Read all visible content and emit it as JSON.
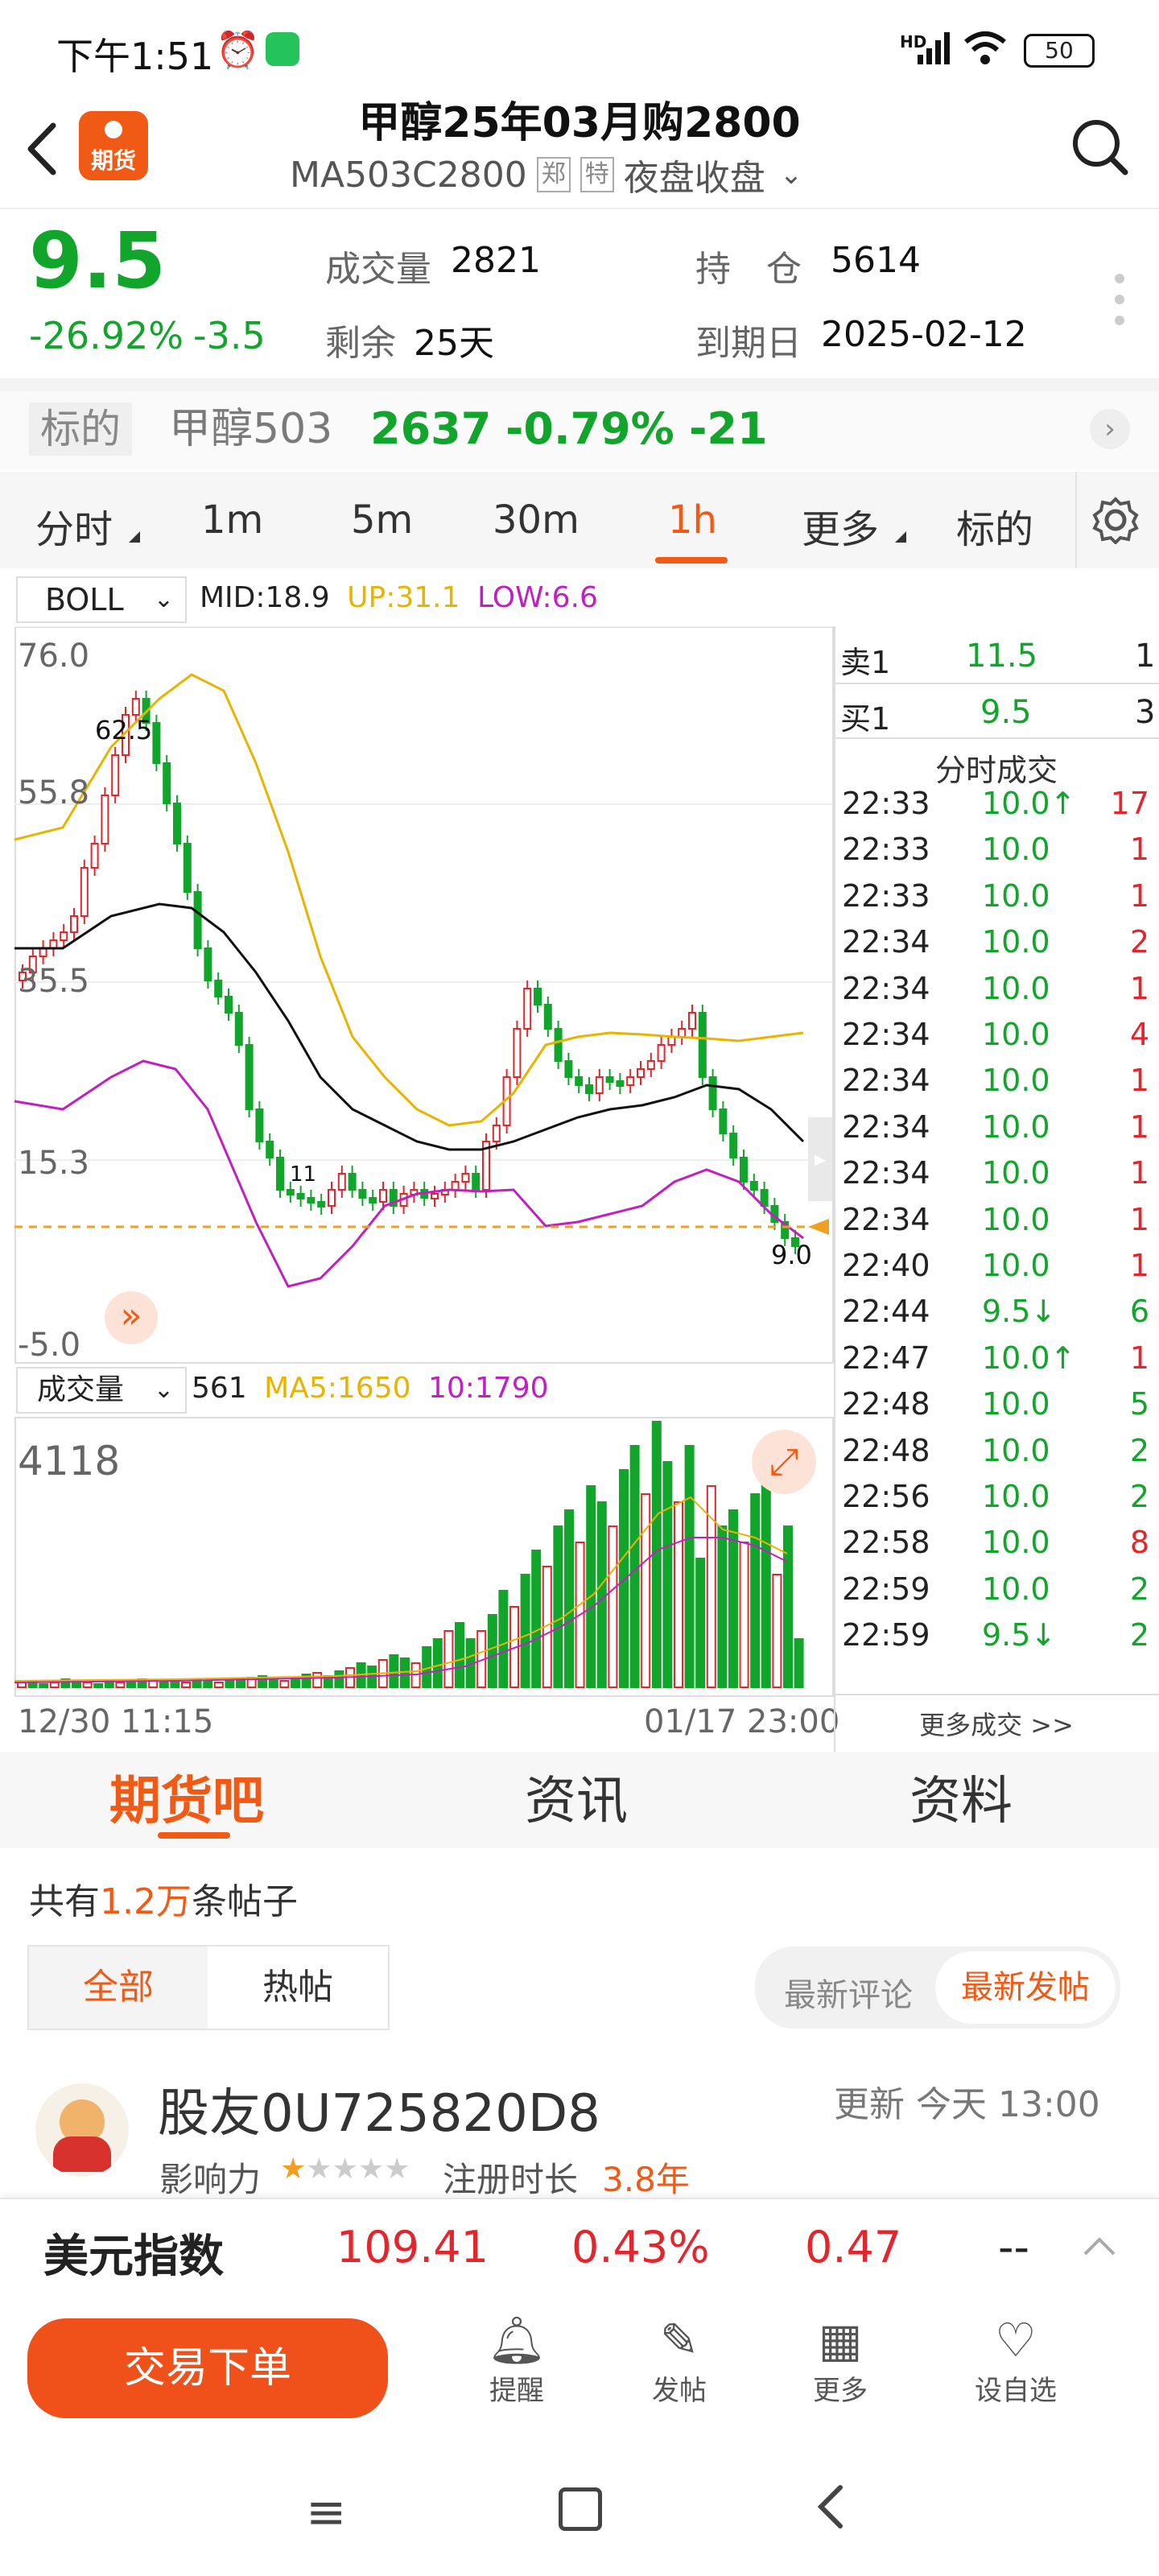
{
  "status_bar": {
    "time": "下午1:51",
    "network": "HD",
    "battery": "50"
  },
  "header": {
    "title": "甲醇25年03月购2800",
    "code": "MA503C2800",
    "tag1": "郑",
    "tag2": "特",
    "session": "夜盘收盘",
    "logo_text": "期货"
  },
  "quote": {
    "price": "9.5",
    "change_pct": "-26.92%",
    "change": "-3.5",
    "volume_label": "成交量",
    "volume": "2821",
    "oi_label": "持　仓",
    "oi": "5614",
    "remain_label": "剩余",
    "remain": "25天",
    "expiry_label": "到期日",
    "expiry": "2025-02-12"
  },
  "underlying": {
    "label": "标的",
    "name": "甲醇503",
    "price": "2637",
    "pct": "-0.79%",
    "change": "-21"
  },
  "timeframes": [
    "分时",
    "1m",
    "5m",
    "30m",
    "1h",
    "更多",
    "标的"
  ],
  "active_timeframe": "1h",
  "indicator": {
    "name": "BOLL",
    "mid": "MID:18.9",
    "up": "UP:31.1",
    "low": "LOW:6.6"
  },
  "chart": {
    "y_labels": [
      "76.0",
      "55.8",
      "35.5",
      "15.3",
      "-5.0"
    ],
    "high_label": "62.5",
    "low_label": "11",
    "last_label": "9.0",
    "x_start": "12/30 11:15",
    "x_end": "01/17 23:00"
  },
  "volume_panel": {
    "name": "成交量",
    "value": "561",
    "ma5": "MA5:1650",
    "ma10": "10:1790",
    "max": "4118"
  },
  "orderbook": {
    "sell_label": "卖1",
    "sell_price": "11.5",
    "sell_qty": "1",
    "buy_label": "买1",
    "buy_price": "9.5",
    "buy_qty": "3",
    "trades_title": "分时成交",
    "more": "更多成交 >>"
  },
  "trades": [
    {
      "time": "22:33",
      "price": "10.0↑",
      "vol": "17",
      "pc": "green",
      "vc": "red"
    },
    {
      "time": "22:33",
      "price": "10.0",
      "vol": "1",
      "pc": "green",
      "vc": "red"
    },
    {
      "time": "22:33",
      "price": "10.0",
      "vol": "1",
      "pc": "green",
      "vc": "red"
    },
    {
      "time": "22:34",
      "price": "10.0",
      "vol": "2",
      "pc": "green",
      "vc": "red"
    },
    {
      "time": "22:34",
      "price": "10.0",
      "vol": "1",
      "pc": "green",
      "vc": "red"
    },
    {
      "time": "22:34",
      "price": "10.0",
      "vol": "4",
      "pc": "green",
      "vc": "red"
    },
    {
      "time": "22:34",
      "price": "10.0",
      "vol": "1",
      "pc": "green",
      "vc": "red"
    },
    {
      "time": "22:34",
      "price": "10.0",
      "vol": "1",
      "pc": "green",
      "vc": "red"
    },
    {
      "time": "22:34",
      "price": "10.0",
      "vol": "1",
      "pc": "green",
      "vc": "red"
    },
    {
      "time": "22:34",
      "price": "10.0",
      "vol": "1",
      "pc": "green",
      "vc": "red"
    },
    {
      "time": "22:40",
      "price": "10.0",
      "vol": "1",
      "pc": "green",
      "vc": "red"
    },
    {
      "time": "22:44",
      "price": "9.5↓",
      "vol": "6",
      "pc": "green",
      "vc": "green"
    },
    {
      "time": "22:47",
      "price": "10.0↑",
      "vol": "1",
      "pc": "green",
      "vc": "red"
    },
    {
      "time": "22:48",
      "price": "10.0",
      "vol": "5",
      "pc": "green",
      "vc": "green"
    },
    {
      "time": "22:48",
      "price": "10.0",
      "vol": "2",
      "pc": "green",
      "vc": "green"
    },
    {
      "time": "22:56",
      "price": "10.0",
      "vol": "2",
      "pc": "green",
      "vc": "green"
    },
    {
      "time": "22:58",
      "price": "10.0",
      "vol": "8",
      "pc": "green",
      "vc": "red"
    },
    {
      "time": "22:59",
      "price": "10.0",
      "vol": "2",
      "pc": "green",
      "vc": "green"
    },
    {
      "time": "22:59",
      "price": "9.5↓",
      "vol": "2",
      "pc": "green",
      "vc": "green"
    }
  ],
  "section_tabs": [
    "期货吧",
    "资讯",
    "资料"
  ],
  "forum": {
    "count_prefix": "共有",
    "count": "1.2万",
    "count_suffix": "条帖子",
    "filter_all": "全部",
    "filter_hot": "热帖",
    "sort_comment": "最新评论",
    "sort_post": "最新发帖"
  },
  "post": {
    "user": "股友0U725820D8",
    "updated": "更新 今天 13:00",
    "influence_label": "影响力",
    "influence_stars": "★☆☆☆☆",
    "reg_label": "注册时长",
    "reg_value": "3.8年"
  },
  "ticker": {
    "name": "美元指数",
    "price": "109.41",
    "pct": "0.43%",
    "change": "0.47",
    "dash": "--"
  },
  "bottom_bar": {
    "trade_button": "交易下单",
    "items": [
      "提醒",
      "发帖",
      "更多",
      "设自选"
    ]
  },
  "colors": {
    "accent": "#f05a14",
    "up": "#e3262c",
    "down": "#12a52c",
    "boll_up": "#e8b400",
    "boll_low": "#c21fc2"
  }
}
